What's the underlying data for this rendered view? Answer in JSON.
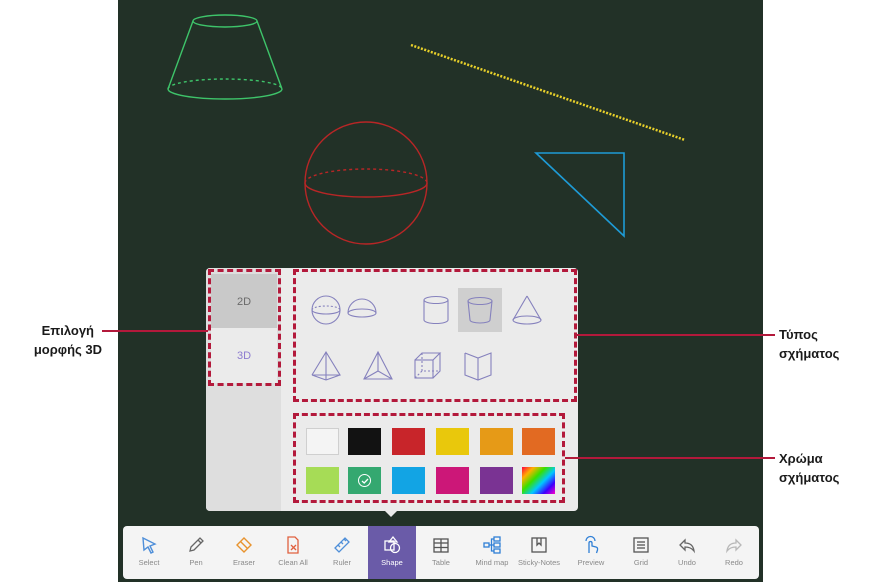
{
  "mode_selector": {
    "option_2d": "2D",
    "option_3d": "3D",
    "selected": "3D"
  },
  "shape_types": {
    "items": [
      "sphere",
      "hemisphere",
      "cylinder",
      "frustum",
      "cone",
      "square-pyramid",
      "triangular-pyramid",
      "cube",
      "prism"
    ],
    "selected": "frustum"
  },
  "colors": {
    "swatches": [
      "#f4f4f4",
      "#121212",
      "#c8252a",
      "#e9c80c",
      "#e69a17",
      "#e26a22",
      "#a6dc56",
      "#34a870",
      "#12a4e4",
      "#cc1778",
      "#7a3393",
      "rainbow"
    ],
    "selected": "#34a870"
  },
  "callouts": {
    "mode_label_line1": "Επιλογή",
    "mode_label_line2": "μορφής 3D",
    "shape_type_line1": "Τύπος",
    "shape_type_line2": "σχήματος",
    "shape_color_line1": "Χρώμα",
    "shape_color_line2": "σχήματος"
  },
  "toolbar": {
    "select": "Select",
    "pen": "Pen",
    "eraser": "Eraser",
    "clear_all": "Clean All",
    "ruler": "Ruler",
    "shape": "Shape",
    "table": "Table",
    "mind_map": "Mind map",
    "sticky_notes": "Sticky-Notes",
    "preview": "Preview",
    "grid": "Grid",
    "undo": "Undo",
    "redo": "Redo",
    "active": "Shape"
  },
  "canvas_drawings": [
    {
      "shape": "frustum",
      "color": "#3ec46a"
    },
    {
      "shape": "line",
      "color": "#e8d02a"
    },
    {
      "shape": "sphere",
      "color": "#b82626"
    },
    {
      "shape": "triangle",
      "color": "#1e9bd6"
    }
  ]
}
